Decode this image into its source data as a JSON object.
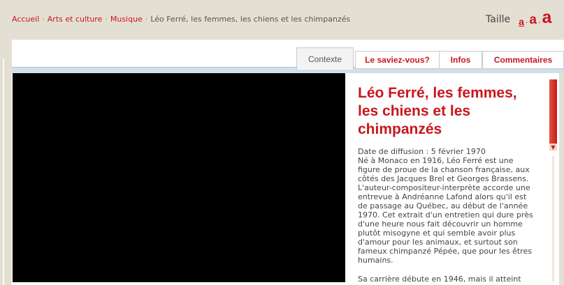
{
  "breadcrumb": {
    "items": [
      {
        "label": "Accueil"
      },
      {
        "label": "Arts et culture"
      },
      {
        "label": "Musique"
      }
    ],
    "separator": "·",
    "current": "Léo Ferré, les femmes, les chiens et les chimpanzés"
  },
  "text_size": {
    "label": "Taille",
    "options": [
      "a",
      "a",
      "a"
    ],
    "dot": "."
  },
  "tabs": [
    {
      "label": "Contexte",
      "active": true
    },
    {
      "label": "Le saviez-vous?",
      "active": false
    },
    {
      "label": "Infos",
      "active": false
    },
    {
      "label": "Commentaires",
      "active": false
    }
  ],
  "article": {
    "title": "Léo Ferré, les femmes, les chiens et les chimpanzés",
    "date_line": "Date de diffusion : 5 février 1970",
    "paragraph1": "Né à Monaco en 1916, Léo Ferré est une figure de proue de la chanson française, aux côtés des Jacques Brel et Georges Brassens. L'auteur-compositeur-interprète accorde une entrevue à Andréanne Lafond alors qu'il est de passage au Québec, au début de l'année 1970. Cet extrait d'un entretien qui dure près d'une heure nous fait découvrir un homme plutôt misogyne et qui semble avoir plus d'amour pour les animaux, et surtout son fameux chimpanzé Pépée, que pour les êtres humains.",
    "paragraph2": "Sa carrière débute en 1946, mais il atteint"
  },
  "colors": {
    "accent": "#c8171d",
    "background": "#e4dfd3",
    "tab_strip": "#cfe0ec"
  },
  "icons": {
    "scroll_up": "triangle-up-icon",
    "scroll_down": "triangle-down-icon"
  }
}
